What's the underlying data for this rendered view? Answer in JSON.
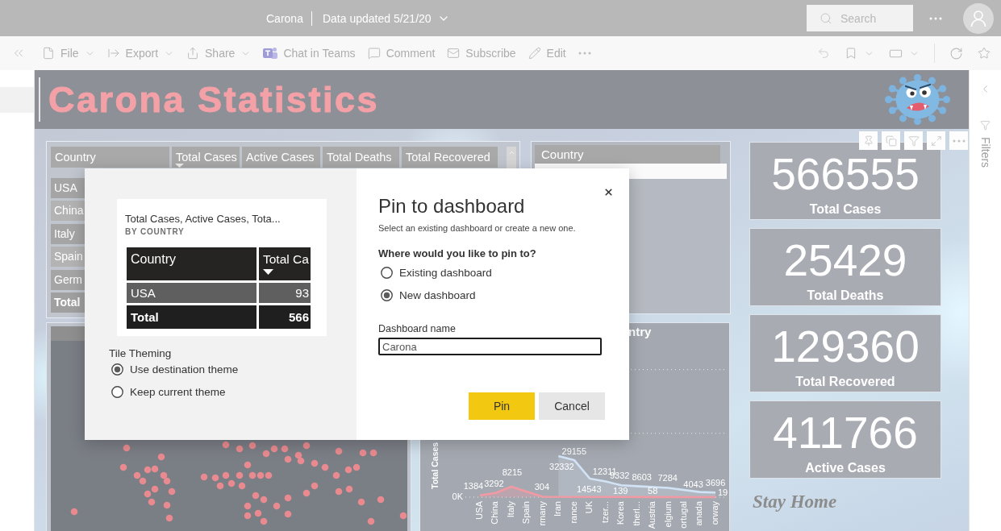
{
  "header": {
    "title": "Carona",
    "subtitle": "Data updated 5/21/20",
    "search": {
      "placeholder": "Search"
    }
  },
  "toolbar": {
    "items": [
      {
        "label": "File",
        "kind": "menu"
      },
      {
        "label": "Export",
        "kind": "menu"
      },
      {
        "label": "Share",
        "kind": "menu"
      },
      {
        "label": "Chat in Teams",
        "kind": "action"
      },
      {
        "label": "Comment",
        "kind": "action"
      },
      {
        "label": "Subscribe",
        "kind": "action"
      },
      {
        "label": "Edit",
        "kind": "action"
      }
    ]
  },
  "report": {
    "title": "Carona Statistics",
    "table": {
      "columns": [
        {
          "label": "Country",
          "sorted": false
        },
        {
          "label": "Total Cases",
          "sorted": true
        },
        {
          "label": "Active Cases",
          "sorted": false
        },
        {
          "label": "Total Deaths",
          "sorted": false
        },
        {
          "label": "Total Recovered",
          "sorted": false
        }
      ],
      "rows": [
        {
          "label": "USA",
          "kind": "row"
        },
        {
          "label": "China",
          "kind": "row"
        },
        {
          "label": "Italy",
          "kind": "row"
        },
        {
          "label": "Spain",
          "kind": "row"
        },
        {
          "label": "Germ",
          "kind": "row"
        },
        {
          "label": "Total",
          "kind": "total"
        }
      ]
    },
    "slicer": {
      "title": "Country"
    },
    "chart": {
      "title": "ntry",
      "chart_data": {
        "type": "area",
        "ylabel": "Total Cases",
        "data_labels": true,
        "categories": [
          "USA",
          "China",
          "Italy",
          "Spain",
          "rmany",
          "Iran",
          "rance",
          "UK",
          "tzer...",
          "Korea",
          "therl...",
          "Austria",
          "elgium",
          "ortugal",
          "anada",
          "orway"
        ],
        "series": [
          {
            "color": "#d2e3f5",
            "values": [
              null,
              null,
              null,
              null,
              null,
              32332,
              29155,
              14543,
              12311,
              9332,
              8603,
              null,
              7284,
              null,
              4043,
              3696
            ]
          },
          {
            "color": "#f29aa4",
            "values": [
              1384,
              3292,
              8215,
              null,
              304,
              null,
              null,
              null,
              null,
              139,
              null,
              58,
              null,
              null,
              null,
              19
            ]
          }
        ],
        "annotations": [
          "0K"
        ]
      }
    },
    "cards": [
      {
        "value": "566555",
        "label": "Total Cases"
      },
      {
        "value": "25429",
        "label": "Total Deaths"
      },
      {
        "value": "129360",
        "label": "Total Recovered"
      },
      {
        "value": "411766",
        "label": "Active Cases"
      }
    ],
    "note": "Stay Home"
  },
  "filters_pane": {
    "label": "Filters"
  },
  "dialog": {
    "title": "Pin to dashboard",
    "subtitle": "Select an existing dashboard or create a new one.",
    "preview": {
      "title": "Total Cases, Active Cases, Tota...",
      "subtitle": "BY COUNTRY",
      "columns": [
        {
          "label": "Country",
          "sorted": false
        },
        {
          "label": "Total Ca",
          "sorted": true
        }
      ],
      "rows": [
        {
          "kind": "row",
          "cells": [
            "USA",
            "93"
          ]
        },
        {
          "kind": "total",
          "cells": [
            "Total",
            "566"
          ]
        }
      ]
    },
    "theming": {
      "label": "Tile Theming",
      "options": [
        {
          "label": "Use destination theme",
          "selected": true
        },
        {
          "label": "Keep current theme",
          "selected": false
        }
      ]
    },
    "destination": {
      "label": "Where would you like to pin to?",
      "options": [
        {
          "label": "Existing dashboard",
          "selected": false
        },
        {
          "label": "New dashboard",
          "selected": true
        }
      ]
    },
    "name_field": {
      "label": "Dashboard name",
      "value": "Carona"
    },
    "buttons": [
      {
        "label": "Pin",
        "kind": "primary"
      },
      {
        "label": "Cancel",
        "kind": "secondary"
      }
    ]
  }
}
